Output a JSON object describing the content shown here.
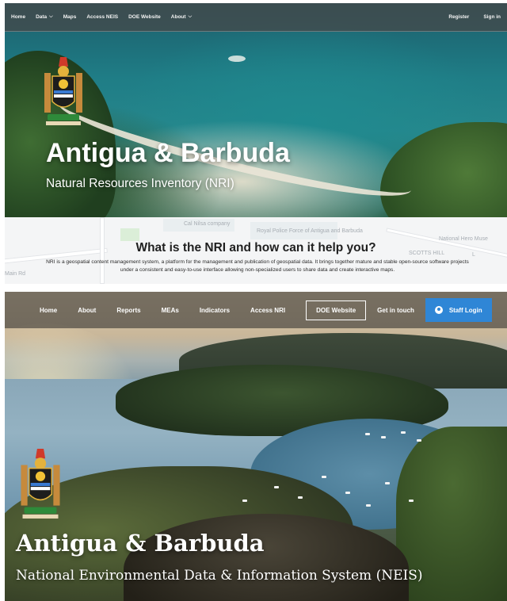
{
  "nri_site": {
    "nav": {
      "items": [
        {
          "label": "Home"
        },
        {
          "label": "Data",
          "has_dropdown": true
        },
        {
          "label": "Maps"
        },
        {
          "label": "Access NEIS"
        },
        {
          "label": "DOE Website"
        },
        {
          "label": "About",
          "has_dropdown": true
        }
      ],
      "register_label": "Register",
      "signin_label": "Sign in"
    },
    "hero": {
      "title": "Antigua & Barbuda",
      "subtitle": "Natural Resources Inventory (NRI)",
      "crest_icon": "coat-of-arms-icon"
    },
    "map_labels": [
      "Main Rd",
      "Cal Nilsa company",
      "Royal Police Force of Antigua and Barbuda",
      "National Hero Muse",
      "SCOTTS HILL",
      "L"
    ],
    "intro": {
      "heading": "What is the NRI and how can it help you?",
      "body": "NRI is a geospatial content management system, a platform for the management and publication of geospatial data. It brings together mature and stable open-source software projects under a consistent and easy-to-use interface allowing non-specialized users to share data and create interactive maps."
    }
  },
  "neis_site": {
    "nav": {
      "items": [
        {
          "label": "Home"
        },
        {
          "label": "About"
        },
        {
          "label": "Reports"
        },
        {
          "label": "MEAs"
        },
        {
          "label": "Indicators"
        },
        {
          "label": "Access NRI"
        },
        {
          "label": "DOE Website",
          "boxed": true
        },
        {
          "label": "Get in touch"
        }
      ],
      "login_label": "Staff Login",
      "login_icon": "user-icon",
      "login_color": "#2f86d6"
    },
    "hero": {
      "title": "Antigua & Barbuda",
      "subtitle": "National Environmental Data & Information System (NEIS)",
      "crest_icon": "coat-of-arms-icon"
    }
  }
}
